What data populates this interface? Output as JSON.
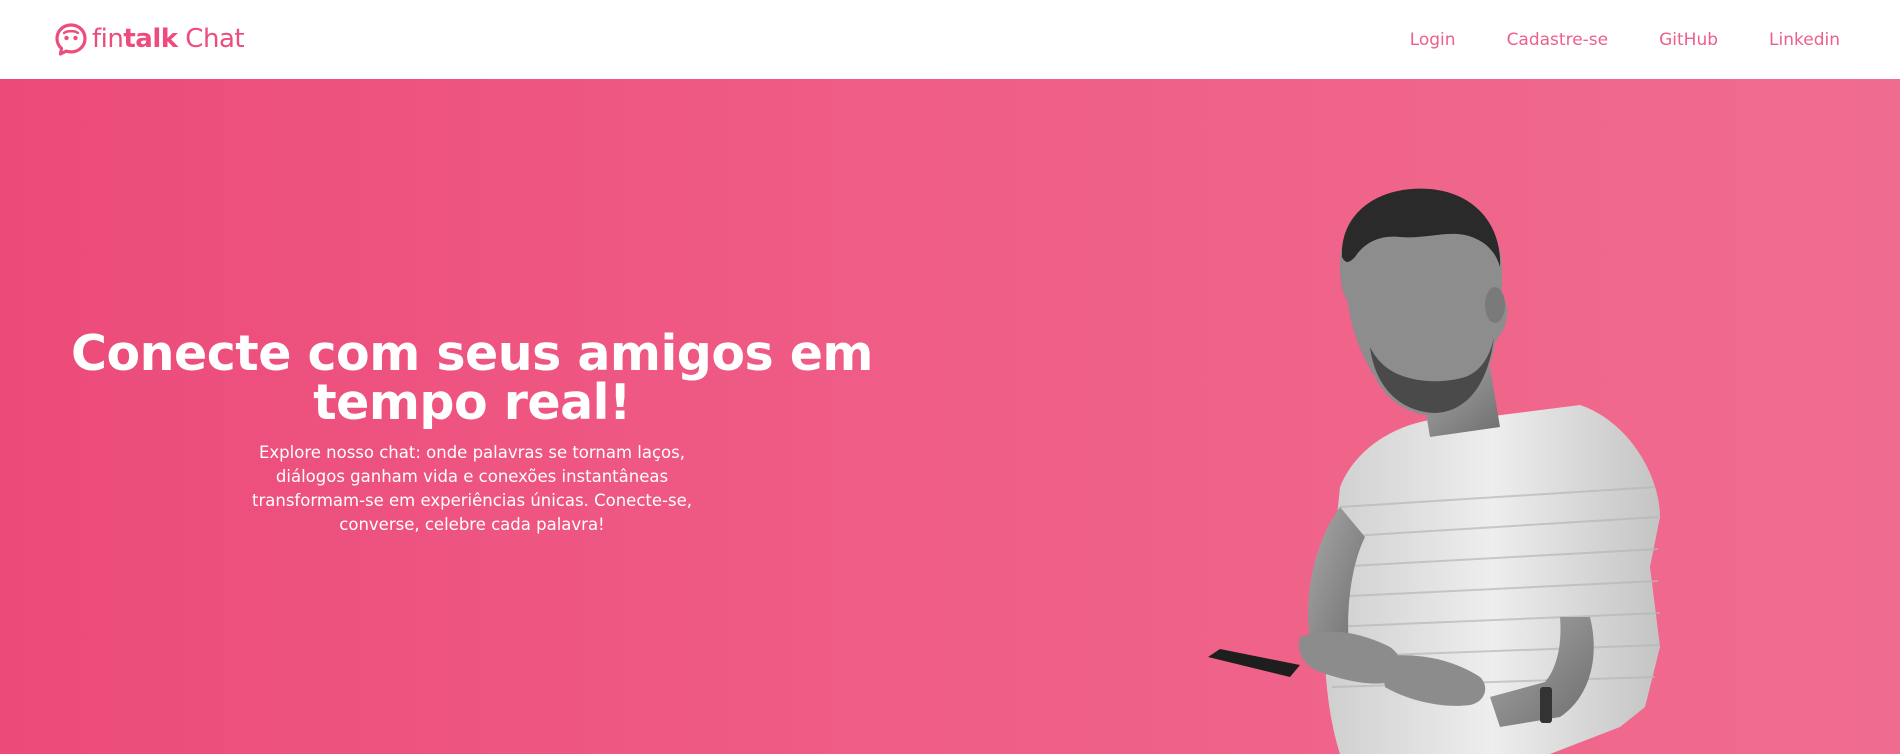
{
  "brand": {
    "name_thin": "fin",
    "name_bold": "talk",
    "name_suffix": " Chat",
    "color": "#ec4d7d",
    "icon": "chat-bubble-smile-icon"
  },
  "nav": {
    "links": [
      {
        "label": "Login"
      },
      {
        "label": "Cadastre-se"
      },
      {
        "label": "GitHub"
      },
      {
        "label": "Linkedin"
      }
    ]
  },
  "hero": {
    "title": "Conecte com seus amigos em tempo real!",
    "description": "Explore nosso chat: onde palavras se tornam laços, diálogos ganham vida e conexões instantâneas transformam-se em experiências únicas. Conecte-se, converse, celebre cada palavra!",
    "background_start": "#ec4b79",
    "background_end": "#f06c8f",
    "image_alt": "man-using-phone"
  }
}
